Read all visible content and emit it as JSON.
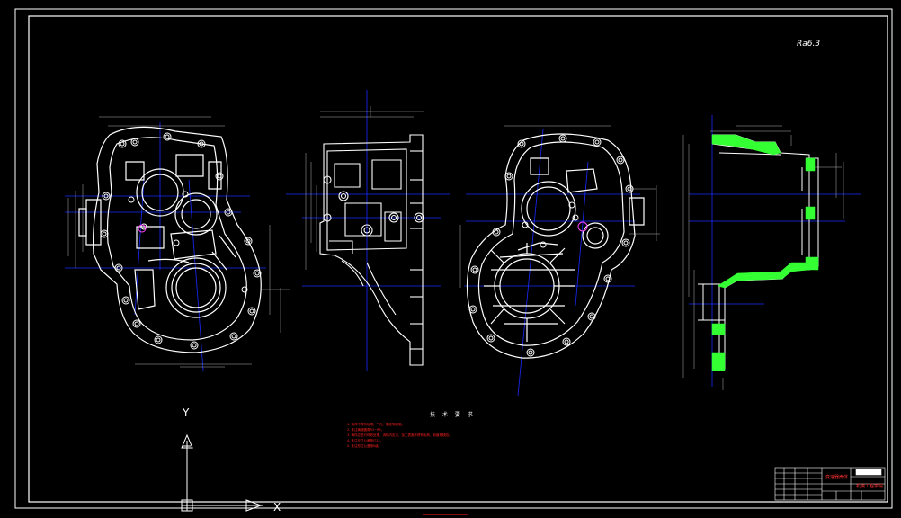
{
  "sheet": {
    "roughness_mark": "Ra6.3",
    "notes": {
      "title": "技 术 要 求",
      "items": [
        "1. 铸件不得有砂眼、气孔、裂纹等缺陷。",
        "2. 未注铸造圆角R3~R5。",
        "3. 铸件应进行时效处理，消除内应力，加工表面不得有毛刺、划痕等缺陷。",
        "4. 未注尺寸公差按IT12。",
        "5. 未注形位公差按K级。"
      ]
    },
    "ucs": {
      "y_label": "Y",
      "x_label": "X"
    },
    "title_block": {
      "drawing_title": "变速器壳体",
      "school": "机械工程学院"
    }
  },
  "colors": {
    "background": "#000000",
    "linework": "#ffffff",
    "center_lines": "#1a2aff",
    "dimensions": "#c8c8c8",
    "hatch": "#33ff33",
    "notes": "#ff2020"
  }
}
